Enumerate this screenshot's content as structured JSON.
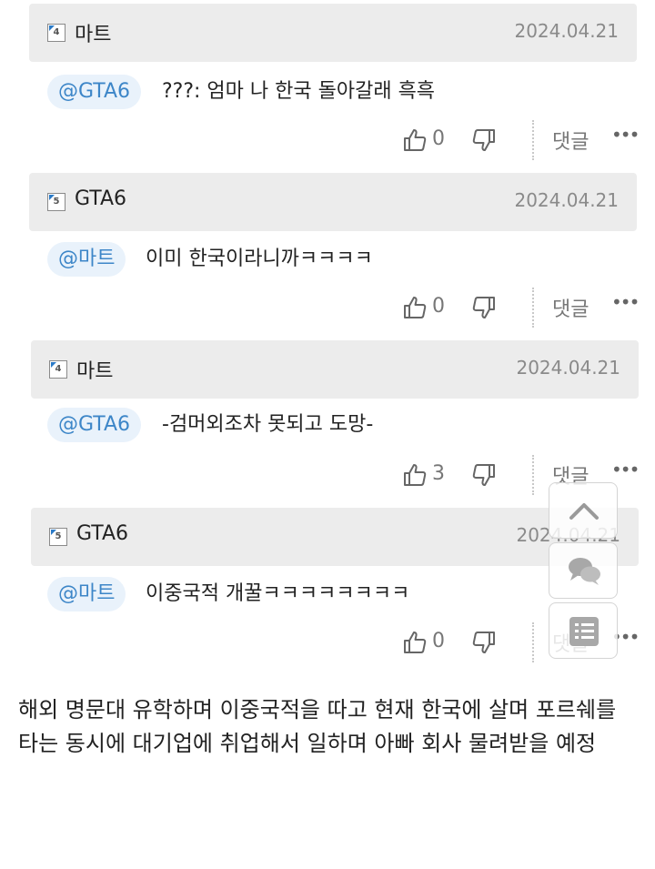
{
  "comments": [
    {
      "level": "4",
      "nickname": "마트",
      "date": "2024.04.21",
      "mention": "@GTA6",
      "text": "???: 엄마 나 한국 돌아갈래 흑흑",
      "likes": "0",
      "reply_label": "댓글"
    },
    {
      "level": "5",
      "nickname": "GTA6",
      "date": "2024.04.21",
      "mention": "@마트",
      "text": "이미 한국이라니까ㅋㅋㅋㅋ",
      "likes": "0",
      "reply_label": "댓글"
    },
    {
      "level": "4",
      "nickname": "마트",
      "date": "2024.04.21",
      "mention": "@GTA6",
      "text": "-검머외조차 못되고 도망-",
      "likes": "3",
      "reply_label": "댓글"
    },
    {
      "level": "5",
      "nickname": "GTA6",
      "date": "2024.04.21",
      "mention": "@마트",
      "text": "이중국적 개꿀ㅋㅋㅋㅋㅋㅋㅋㅋ",
      "likes": "0",
      "reply_label": "댓글"
    }
  ],
  "more_glyph": "•••",
  "caption": "해외 명문대 유학하며 이중국적을 따고 현재 한국에 살며 포르쉐를 타는 동시에 대기업에 취업해서 일하며 아빠 회사 물려받을 예정",
  "icons": {
    "like": "thumbs-up-icon",
    "dislike": "thumbs-down-icon",
    "scroll_top": "chevron-up-icon",
    "chat": "chat-bubbles-icon",
    "list": "list-icon"
  },
  "colors": {
    "header_bg": "#ececec",
    "mention_bg": "#e9f2fb",
    "mention_text": "#3d86c8",
    "date_text": "#8a8a8a"
  }
}
